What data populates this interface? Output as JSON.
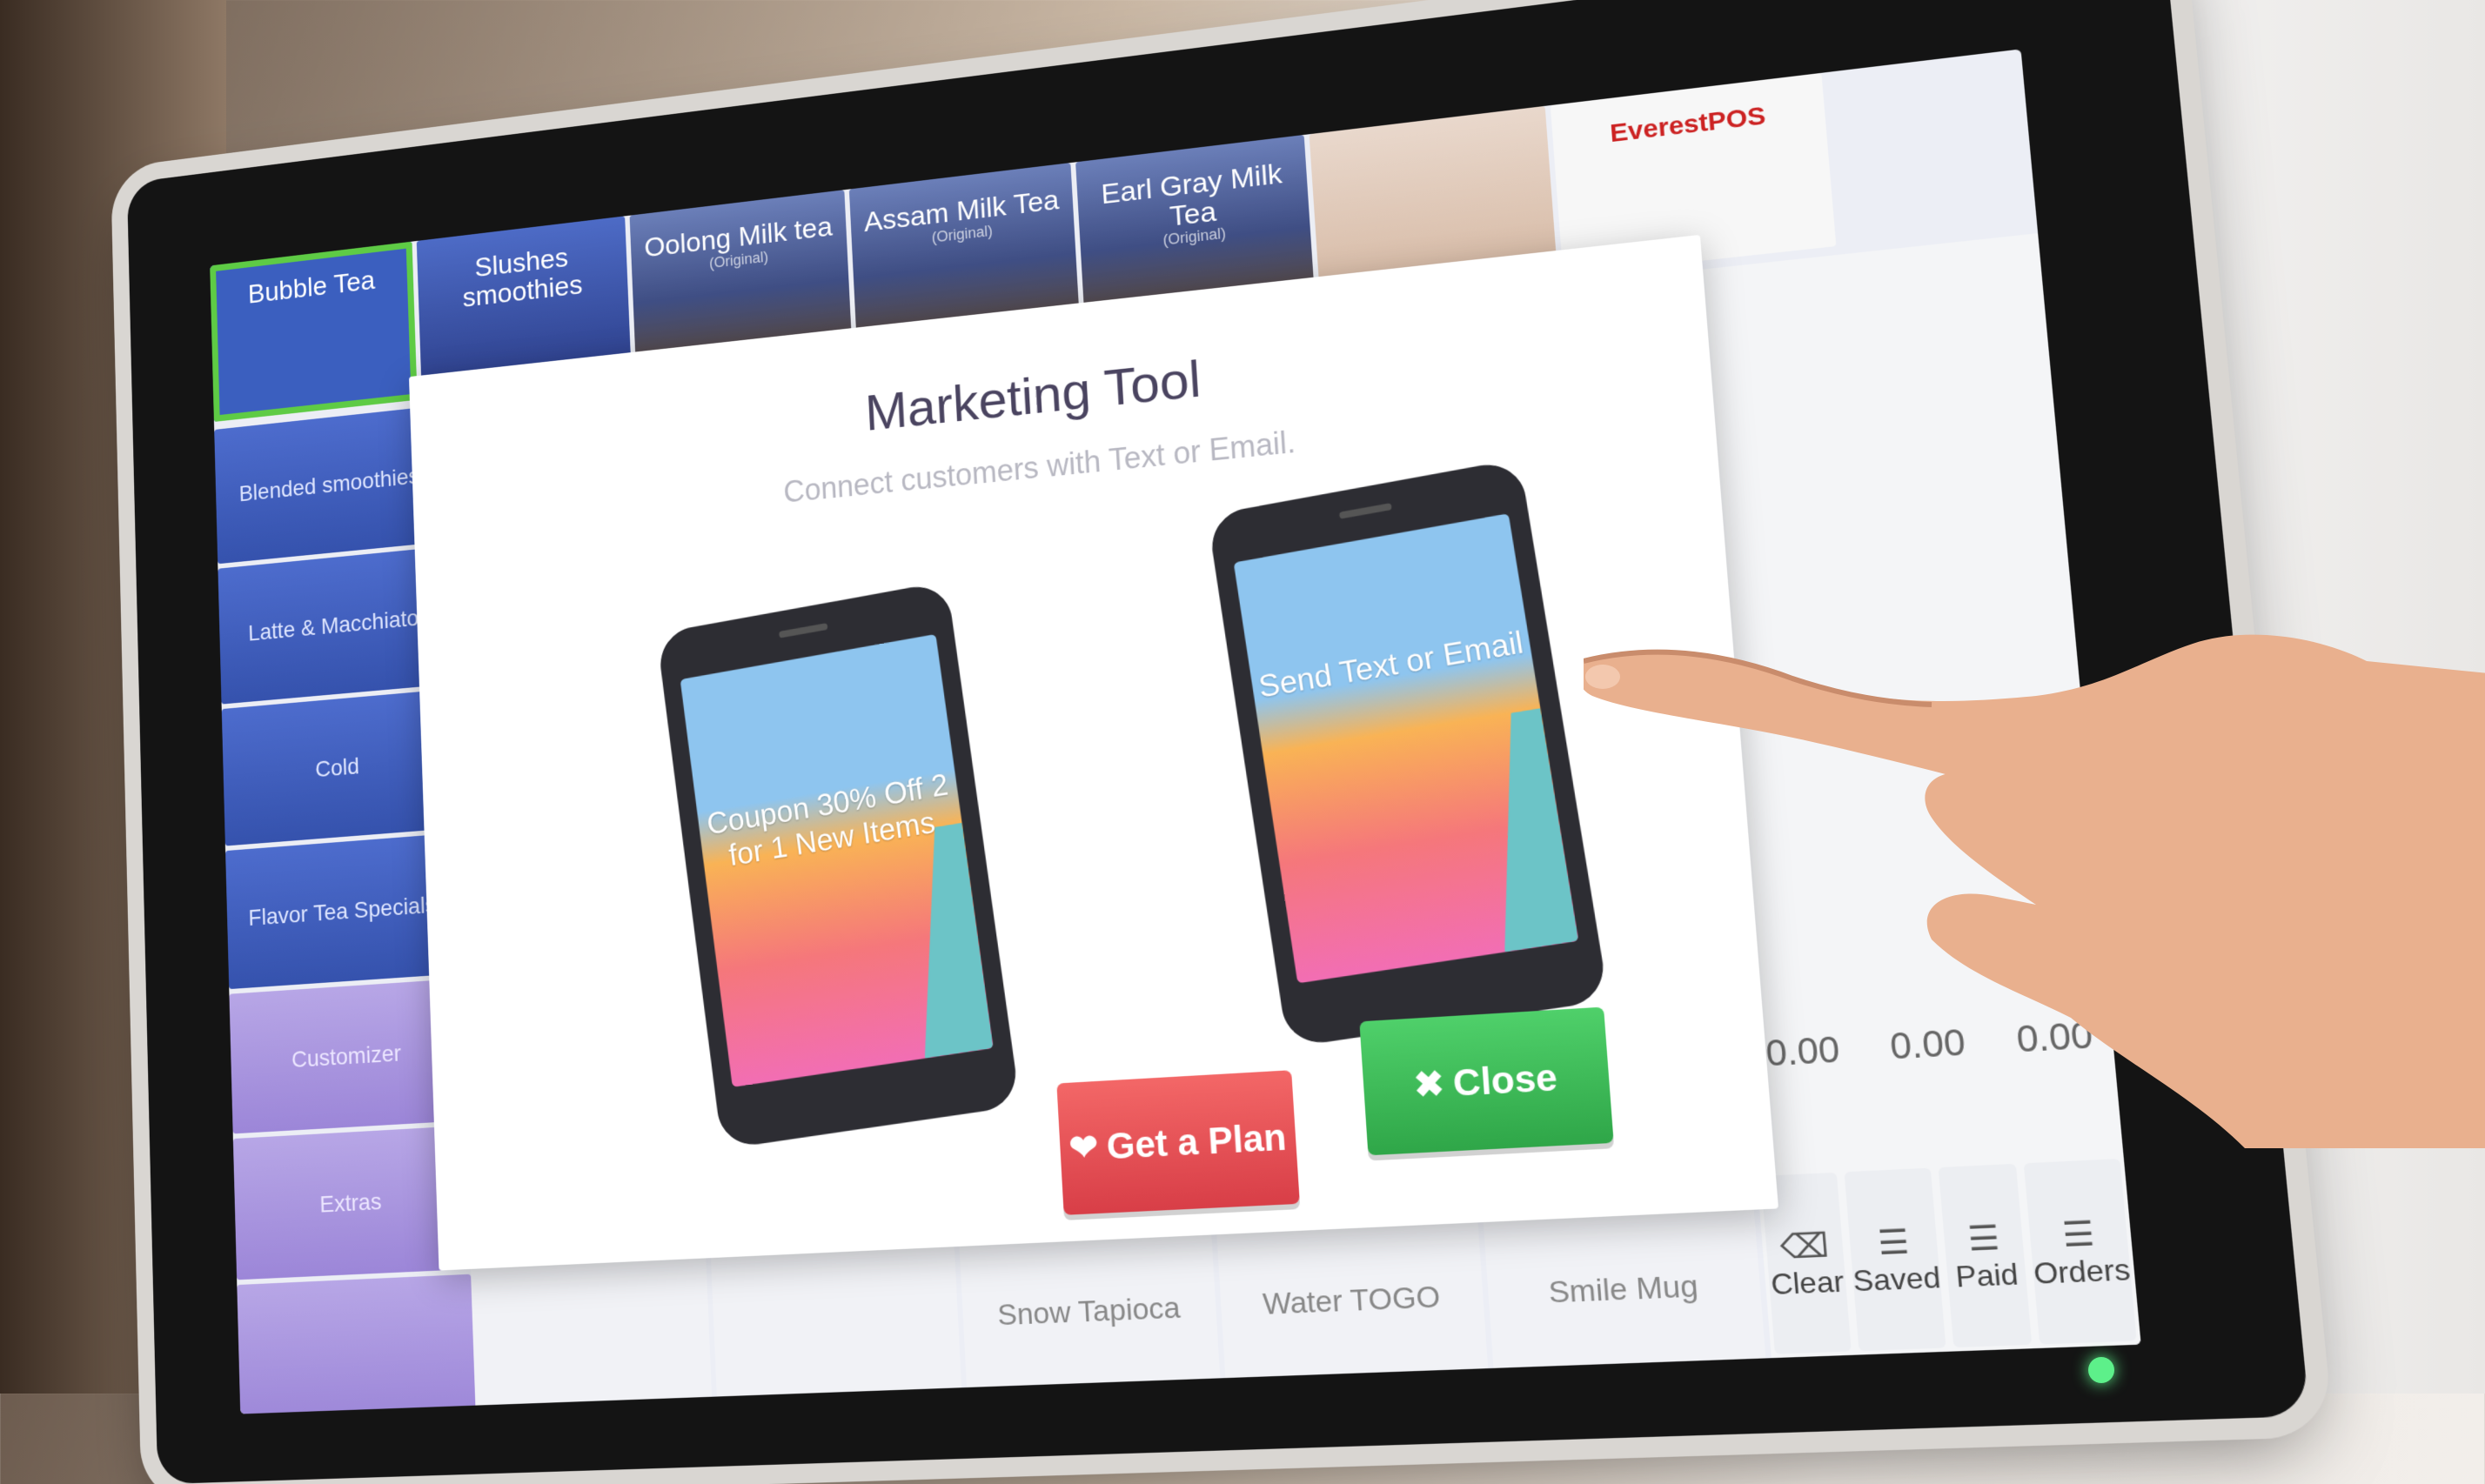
{
  "top_tiles": [
    {
      "label": "Bubble Tea",
      "sub": ""
    },
    {
      "label": "Slushes smoothies",
      "sub": ""
    },
    {
      "label": "Oolong Milk tea",
      "sub": "(Original)"
    },
    {
      "label": "Assam Milk Tea",
      "sub": "(Original)"
    },
    {
      "label": "Earl Gray Milk Tea",
      "sub": "(Original)"
    },
    {
      "label": "",
      "sub": ""
    },
    {
      "label": "EverestPOS",
      "sub": ""
    }
  ],
  "left_categories": [
    {
      "label": "Blended smoothies"
    },
    {
      "label": "Latte & Macchiato"
    },
    {
      "label": "Cold"
    },
    {
      "label": "Flavor Tea Specials"
    },
    {
      "label": "Customizer"
    },
    {
      "label": "Extras"
    },
    {
      "label": ""
    }
  ],
  "bottom_products": [
    {
      "label": ""
    },
    {
      "label": ""
    },
    {
      "label": "Snow Tapioca"
    },
    {
      "label": "Water TOGO"
    },
    {
      "label": "Smile Mug"
    }
  ],
  "totals": {
    "value_1": "0.00",
    "value_2": "0.00",
    "value_3": "0.00"
  },
  "actions": [
    {
      "label": "Clear",
      "icon": "eraser-icon"
    },
    {
      "label": "Saved",
      "icon": "list-icon"
    },
    {
      "label": "Paid",
      "icon": "list-icon"
    },
    {
      "label": "Orders",
      "icon": "list-icon"
    }
  ],
  "modal": {
    "title": "Marketing Tool",
    "subtitle": "Connect customers with Text or Email.",
    "phone_left_text": "Coupon 30% Off 2 for 1 New Items",
    "phone_right_text": "Send Text or Email",
    "plan_button": "Get a Plan",
    "close_button": "Close"
  },
  "colors": {
    "active_outline": "#5ecb45",
    "plan_button": "#e24b52",
    "close_button": "#3cbb56",
    "tile_blue": "#3552ad"
  }
}
